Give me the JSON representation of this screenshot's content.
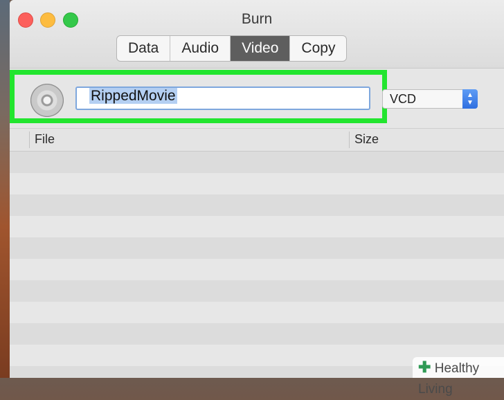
{
  "window": {
    "title": "Burn"
  },
  "tabs": [
    {
      "label": "Data"
    },
    {
      "label": "Audio"
    },
    {
      "label": "Video"
    },
    {
      "label": "Copy"
    }
  ],
  "toolbar": {
    "disc_name": "RippedMovie",
    "format_value": "VCD"
  },
  "table": {
    "headers": {
      "file": "File",
      "size": "Size"
    }
  },
  "watermark": {
    "text": "Healthy Living"
  },
  "icons": {
    "disc": "cd-disc-icon",
    "select_arrow": "chevron-up-down-icon",
    "watermark_mark": "plus-icon"
  },
  "colors": {
    "highlight": "#22e52e",
    "active_tab": "#5e5e5e",
    "close": "#fc605c",
    "minimize": "#fdbc40",
    "zoom": "#34c84a"
  }
}
